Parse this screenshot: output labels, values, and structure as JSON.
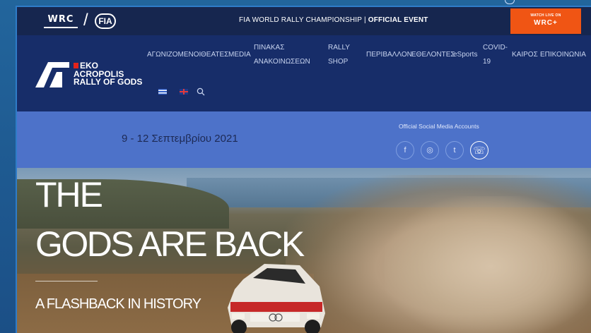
{
  "topbar": {
    "wrc_logo": "WRC",
    "fia_logo": "FIA",
    "title_regular": "FIA WORLD RALLY CHAMPIONSHIP | ",
    "title_bold": "OFFICIAL EVENT",
    "watch_live_line1": "WATCH LIVE ON",
    "watch_live_line2": "WRC+"
  },
  "brand": {
    "line1": "EKO",
    "line2": "ACROPOLIS",
    "line3": "RALLY OF GODS"
  },
  "nav": {
    "items": [
      {
        "label": "ΑΓΩΝΙΖΟΜΕΝΟΙ"
      },
      {
        "label": "ΘΕΑΤΕΣ"
      },
      {
        "label": "MEDIA"
      },
      {
        "label": "ΠΙΝΑΚΑΣ"
      },
      {
        "label": "ΑΝΑΚΟΙΝΩΣΕΩΝ"
      },
      {
        "label": "RALLY"
      },
      {
        "label": "SHOP"
      },
      {
        "label": "ΠΕΡΙΒΑΛΛΟΝ"
      },
      {
        "label": "ΕΘΕΛΟΝΤΕΣ"
      },
      {
        "label": "eSports"
      },
      {
        "label": "COVID-"
      },
      {
        "label": "19"
      },
      {
        "label": "ΚΑΙΡΟΣ"
      },
      {
        "label": "ΕΠΙΚΟΙΝΩΝΙΑ"
      }
    ]
  },
  "strip": {
    "dates": "9 - 12 Σεπτεμβρίου 2021",
    "social_title": "Official Social Media Accounts",
    "social": [
      {
        "icon": "facebook-icon",
        "glyph": "f"
      },
      {
        "icon": "instagram-icon",
        "glyph": "◎"
      },
      {
        "icon": "twitter-icon",
        "glyph": "t"
      },
      {
        "icon": "viber-icon",
        "glyph": "☏"
      }
    ]
  },
  "hero": {
    "line1": "THE",
    "line2": "GODS ARE BACK",
    "subtitle": "A FLASHBACK IN HISTORY"
  },
  "colors": {
    "topbar": "#16264f",
    "nav": "#172d69",
    "strip": "#4d72c9",
    "accent": "#f05514"
  }
}
